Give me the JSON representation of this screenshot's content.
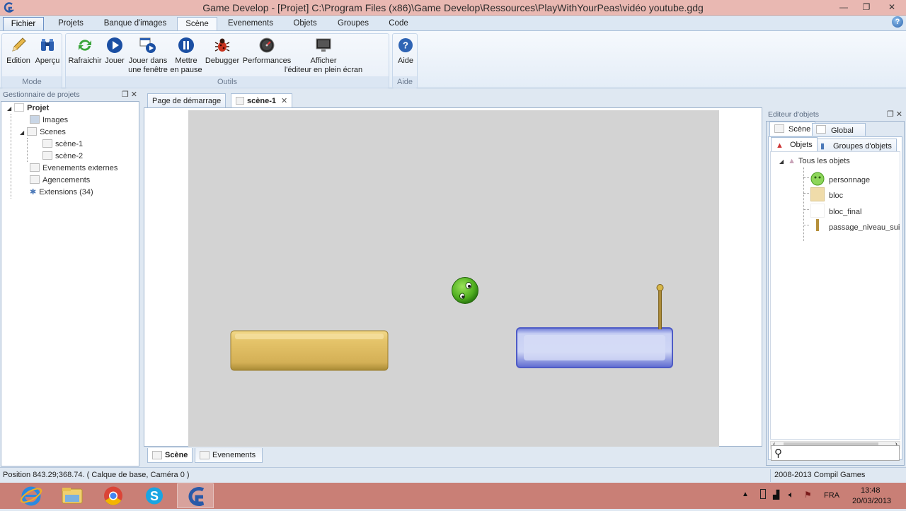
{
  "window": {
    "title": "Game Develop - [Projet] C:\\Program Files (x86)\\Game Develop\\Ressources\\PlayWithYourPeas\\vidéo youtube.gdg",
    "minimize_glyph": "—",
    "restore_glyph": "❐",
    "close_glyph": "✕"
  },
  "menu": {
    "file": "Fichier",
    "projets": "Projets",
    "banque": "Banque d'images",
    "scene": "Scène",
    "evenements": "Evenements",
    "objets": "Objets",
    "groupes": "Groupes",
    "code": "Code",
    "help_glyph": "?"
  },
  "ribbon": {
    "mode": {
      "label": "Mode",
      "edition": "Edition",
      "apercu": "Aperçu"
    },
    "outils": {
      "label": "Outils",
      "rafraichir": "Rafraichir",
      "jouer": "Jouer",
      "jouer_fenetre_1": "Jouer dans",
      "jouer_fenetre_2": "une fenêtre",
      "pause_1": "Mettre",
      "pause_2": "en pause",
      "debugger": "Debugger",
      "performances": "Performances",
      "plein_ecran_1": "Afficher",
      "plein_ecran_2": "l'éditeur en plein écran"
    },
    "aide": {
      "label": "Aide",
      "aide": "Aide"
    }
  },
  "project_manager": {
    "title": "Gestionnaire de projets",
    "tree": {
      "root": "Projet",
      "images": "Images",
      "scenes": "Scenes",
      "scene1": "scène-1",
      "scene2": "scène-2",
      "events_ext": "Evenements externes",
      "agencements": "Agencements",
      "extensions": "Extensions (34)"
    }
  },
  "doc_tabs": {
    "start_page": "Page de démarrage",
    "scene1": "scène-1",
    "close_glyph": "✕"
  },
  "bottom_tabs": {
    "scene": "Scène",
    "events": "Evenements"
  },
  "object_editor": {
    "title": "Editeur d'objets",
    "tab_scene": "Scène",
    "tab_global": "Global",
    "subtab_objets": "Objets",
    "subtab_groupes": "Groupes d'objets",
    "all_objects": "Tous les objets",
    "objects": [
      "personnage",
      "bloc",
      "bloc_final",
      "passage_niveau_suiv"
    ],
    "search_placeholder": ""
  },
  "status": {
    "position": "Position 843.29;368.74. ( Calque de base, Caméra 0 )",
    "copyright": "2008-2013 Compil Games"
  },
  "taskbar": {
    "lang": "FRA",
    "time": "13:48",
    "date": "20/03/2013"
  },
  "colors": {
    "title_bar": "#e9b8b2",
    "taskbar": "#c97f76",
    "scene_bg": "#d3d3d3",
    "bloc_gold": "#d9b85a",
    "bloc_blue": "#b8c2ee",
    "pea_green": "#4fae1f"
  }
}
